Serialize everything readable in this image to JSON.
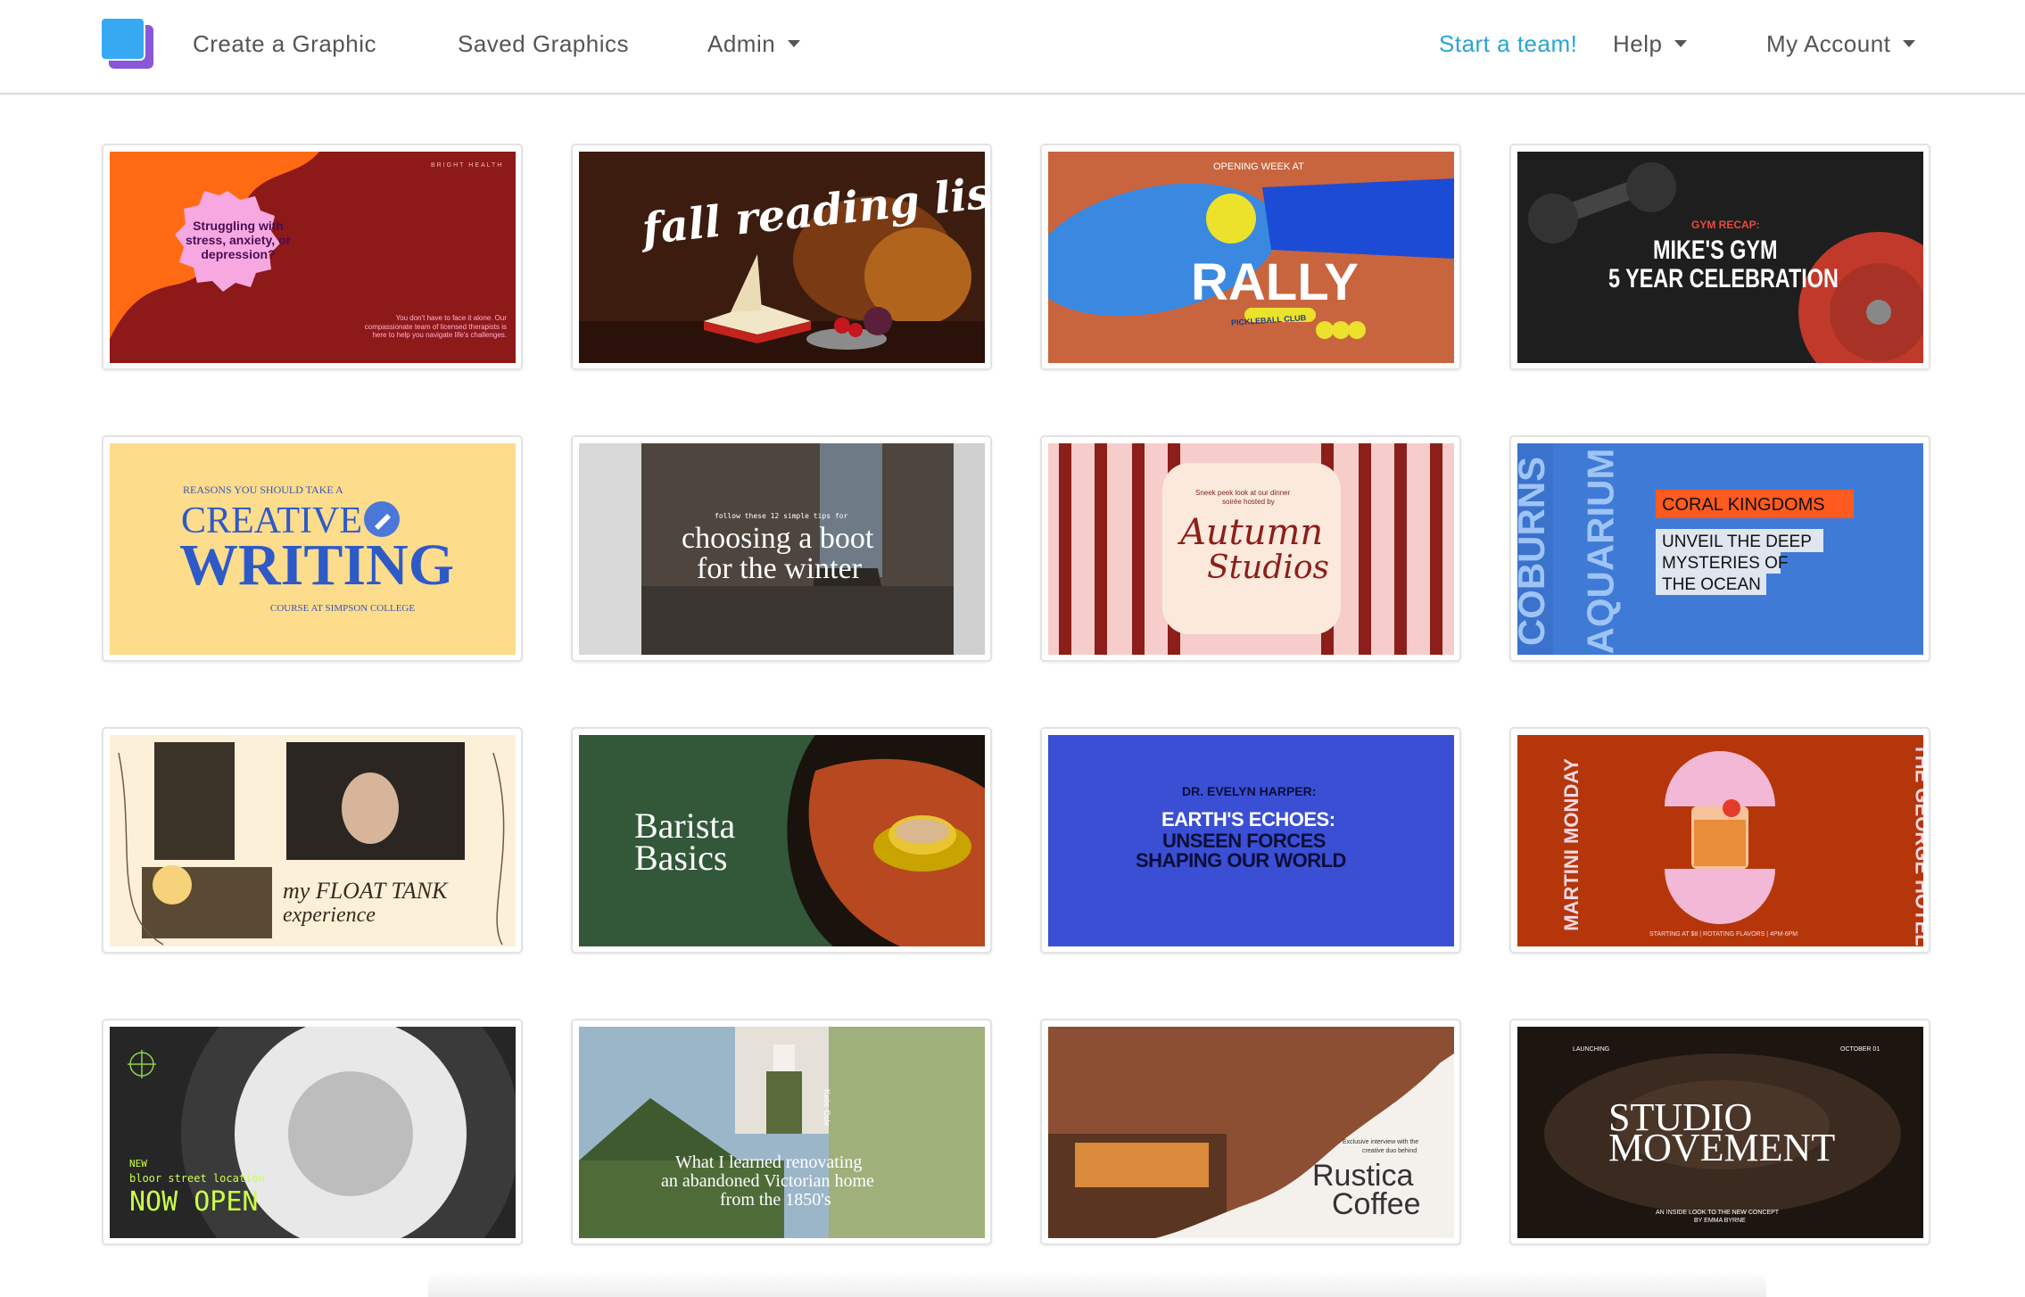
{
  "nav": {
    "create": "Create a Graphic",
    "saved": "Saved Graphics",
    "admin": "Admin",
    "start_team": "Start a team!",
    "help": "Help",
    "account": "My Account"
  },
  "cards": {
    "c1": {
      "brand": "BRIGHT HEALTH",
      "headline": "Struggling with stress, anxiety, or depression?",
      "body": "You don't have to face it alone. Our compassionate team of licensed therapists is here to help you navigate life's challenges."
    },
    "c2": {
      "title": "fall reading list"
    },
    "c3": {
      "kicker": "OPENING WEEK AT",
      "title": "RALLY",
      "badge": "PICKLEBALL CLUB"
    },
    "c4": {
      "kicker": "GYM RECAP:",
      "line1": "MIKE'S GYM",
      "line2": "5 YEAR CELEBRATION"
    },
    "c5": {
      "kicker": "REASONS YOU SHOULD TAKE A",
      "line1": "CREATIVE",
      "line2": "WRITING",
      "sub": "COURSE AT SIMPSON COLLEGE"
    },
    "c6": {
      "kicker": "follow these 12 simple tips for",
      "line1": "choosing a boot",
      "line2": "for the winter"
    },
    "c7": {
      "kicker1": "Sneek peek look at our dinner",
      "kicker2": "soirée hosted by",
      "line1": "Autumn",
      "line2": "Studios"
    },
    "c8": {
      "side1": "COBURNS",
      "side2": "AQUARIUM",
      "tag": "CORAL KINGDOMS",
      "l1": "UNVEIL THE DEEP",
      "l2": "MYSTERIES OF",
      "l3": "THE OCEAN"
    },
    "c9": {
      "line1": "my FLOAT TANK",
      "line2": "experience"
    },
    "c10": {
      "line1": "Barista",
      "line2": "Basics"
    },
    "c11": {
      "kicker": "DR. EVELYN HARPER:",
      "l1": "EARTH'S ECHOES:",
      "l2": "UNSEEN FORCES",
      "l3": "SHAPING OUR WORLD"
    },
    "c12": {
      "left": "MARTINI MONDAY",
      "right": "THE GEORGE HOTEL",
      "footer": "STARTING AT $8 | ROTATING FLAVORS | 4PM-6PM"
    },
    "c13": {
      "l1": "NEW",
      "l2": "bloor street location",
      "l3": "NOW OPEN"
    },
    "c14": {
      "side": "Katie Cole",
      "l1": "What I learned renovating",
      "l2": "an abandoned Victorian home",
      "l3": "from the 1850's"
    },
    "c15": {
      "k1": "Exclusive interview with the",
      "k2": "creative duo behind",
      "l1": "Rustica",
      "l2": "Coffee"
    },
    "c16": {
      "left": "LAUNCHING",
      "right": "OCTOBER 01",
      "l1": "STUDIO",
      "l2": "MOVEMENT",
      "sub1": "AN INSIDE LOOK TO THE NEW CONCEPT",
      "sub2": "BY EMMA BYRNE"
    }
  }
}
